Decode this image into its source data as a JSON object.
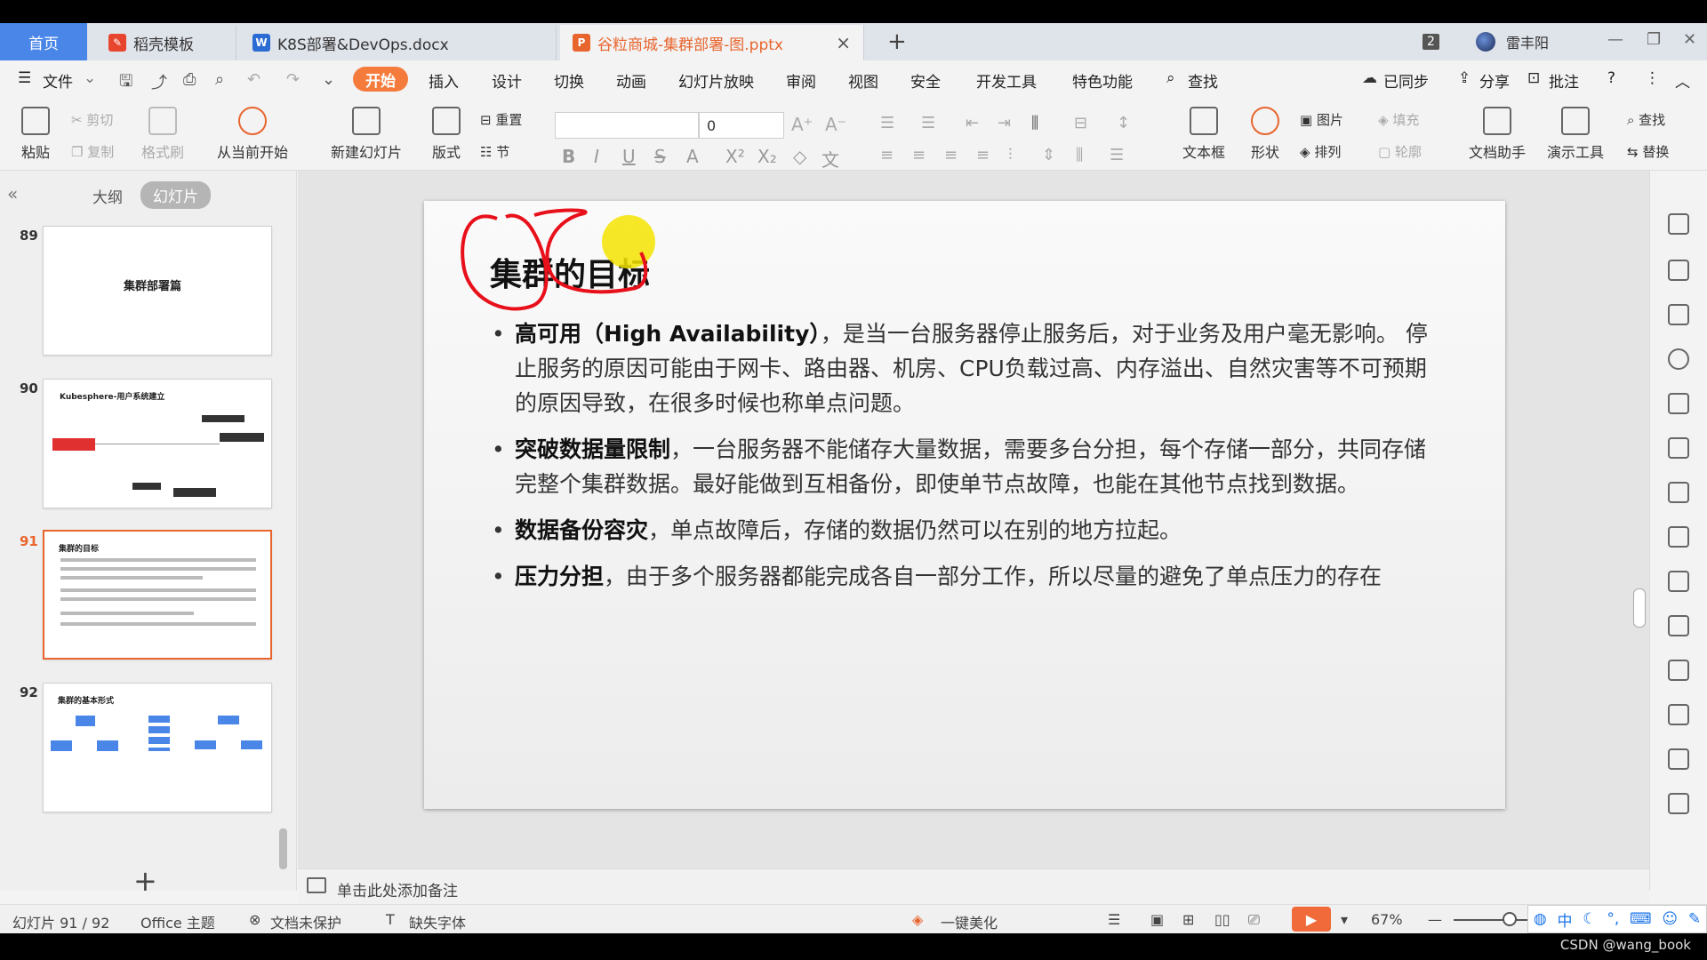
{
  "tabs": {
    "home": "首页",
    "items": [
      {
        "label": "稻壳模板",
        "icon": "wps-docer-icon",
        "color": "#e8452e"
      },
      {
        "label": "K8S部署&DevOps.docx",
        "icon": "word-doc-icon",
        "color": "#2b6cd4"
      },
      {
        "label": "谷粒商城-集群部署-图.pptx",
        "icon": "ppt-doc-icon",
        "color": "#e8652e"
      }
    ],
    "add": "+",
    "close": "×",
    "window_count": "2",
    "user": "雷丰阳"
  },
  "menu": {
    "file": "文件",
    "items": [
      "开始",
      "插入",
      "设计",
      "切换",
      "动画",
      "幻灯片放映",
      "审阅",
      "视图",
      "安全",
      "开发工具",
      "特色功能"
    ],
    "search": "查找",
    "sync": "已同步",
    "share": "分享",
    "comment": "批注",
    "help": "?"
  },
  "ribbon": {
    "paste": "粘贴",
    "cut": "剪切",
    "copy": "复制",
    "format_painter": "格式刷",
    "from_current": "从当前开始",
    "new_slide": "新建幻灯片",
    "layout": "版式",
    "reset": "重置",
    "section": "节",
    "font_size": "0",
    "textbox": "文本框",
    "shape": "形状",
    "picture": "图片",
    "fill": "填充",
    "arrange": "排列",
    "outline": "轮廓",
    "doc_assistant": "文档助手",
    "present_tool": "演示工具",
    "find": "查找",
    "replace": "替换"
  },
  "left_panel": {
    "tab_outline": "大纲",
    "tab_slides": "幻灯片",
    "thumbs": [
      {
        "num": "89",
        "title": "集群部署篇"
      },
      {
        "num": "90",
        "title": "Kubesphere-用户系统建立"
      },
      {
        "num": "91",
        "title": "集群的目标"
      },
      {
        "num": "92",
        "title": "集群的基本形式"
      }
    ],
    "add": "+"
  },
  "slide": {
    "title": "集群的目标",
    "bullets": [
      {
        "bold": "高可用（High Availability）",
        "text": "，是当一台服务器停止服务后，对于业务及用户毫无影响。 停止服务的原因可能由于网卡、路由器、机房、CPU负载过高、内存溢出、自然灾害等不可预期的原因导致，在很多时候也称单点问题。"
      },
      {
        "bold": "突破数据量限制",
        "text": "，一台服务器不能储存大量数据，需要多台分担，每个存储一部分，共同存储完整个集群数据。最好能做到互相备份，即使单节点故障，也能在其他节点找到数据。"
      },
      {
        "bold": "数据备份容灾",
        "text": "，单点故障后，存储的数据仍然可以在别的地方拉起。"
      },
      {
        "bold": "压力分担",
        "text": "，由于多个服务器都能完成各自一部分工作，所以尽量的避免了单点压力的存在"
      }
    ]
  },
  "notes": {
    "placeholder": "单击此处添加备注"
  },
  "status": {
    "slide_index": "幻灯片 91 / 92",
    "theme": "Office 主题",
    "protect": "文档未保护",
    "missing_font": "缺失字体",
    "beautify": "一键美化",
    "zoom": "67%"
  },
  "ime": {
    "label": "中"
  },
  "watermark": "CSDN @wang_book"
}
